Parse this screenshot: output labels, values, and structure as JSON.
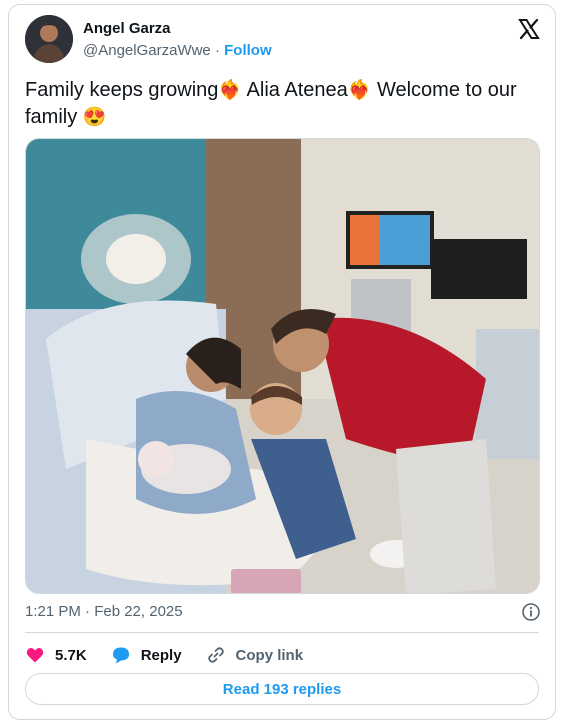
{
  "author": {
    "name": "Angel Garza",
    "handle": "@AngelGarzaWwe",
    "separator": "·",
    "follow_label": "Follow"
  },
  "tweet": {
    "text_part1": "Family keeps growing",
    "emoji1": "❤️‍🔥",
    "text_part2": " Alia Atenea",
    "emoji2": "❤️‍🔥",
    "text_part3": " Welcome to our family ",
    "emoji3": "😍"
  },
  "timestamp": "1:21 PM · Feb 22, 2025",
  "actions": {
    "likes_count": "5.7K",
    "reply_label": "Reply",
    "copy_label": "Copy link"
  },
  "read_replies_label": "Read 193 replies",
  "colors": {
    "accent": "#1d9bf0",
    "like": "#f91880",
    "text_secondary": "#536471",
    "border": "#cfd9de"
  },
  "icons": [
    "x-logo-icon",
    "heart-icon",
    "reply-bubble-icon",
    "link-icon",
    "info-icon"
  ]
}
